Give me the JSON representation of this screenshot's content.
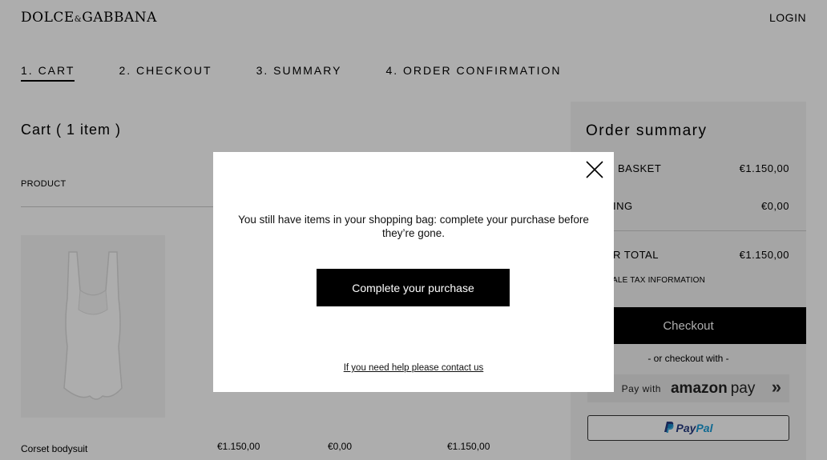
{
  "header": {
    "logo_left": "DOLCE",
    "logo_amp": "&",
    "logo_right": "GABBANA",
    "login_label": "LOGIN"
  },
  "steps": [
    {
      "label": "1. CART",
      "active": true
    },
    {
      "label": "2. CHECKOUT",
      "active": false
    },
    {
      "label": "3. SUMMARY",
      "active": false
    },
    {
      "label": "4. ORDER CONFIRMATION",
      "active": false
    }
  ],
  "cart": {
    "title": "Cart ( 1 item )",
    "column_product": "PRODUCT",
    "item": {
      "name": "Corset bodysuit",
      "price": "€1.150,00",
      "shipping": "€0,00",
      "total": "€1.150,00"
    }
  },
  "summary": {
    "title": "Order summary",
    "basket_label": "BASKET",
    "basket_value": "€1.150,00",
    "shipping_label": "ING",
    "shipping_value": "€0,00",
    "total_label": "R TOTAL",
    "total_value": "€1.150,00",
    "tax_info": "ALE TAX INFORMATION",
    "checkout_label": "Checkout",
    "or_text": "- or checkout with -",
    "amazon_pay_with": "Pay with",
    "amazon_brand": "amazon",
    "amazon_pay": "pay",
    "paypal_pay": "Pay",
    "paypal_pal": "Pal"
  },
  "modal": {
    "message": "You still have items in your shopping bag: complete your purchase before they’re gone.",
    "button_label": "Complete your purchase",
    "help_link": "If you need help please contact us"
  },
  "colors": {
    "overlay": "#000000",
    "paypal_dark": "#253b80",
    "paypal_light": "#179bd7",
    "amazon_smile": "#f59a23"
  }
}
